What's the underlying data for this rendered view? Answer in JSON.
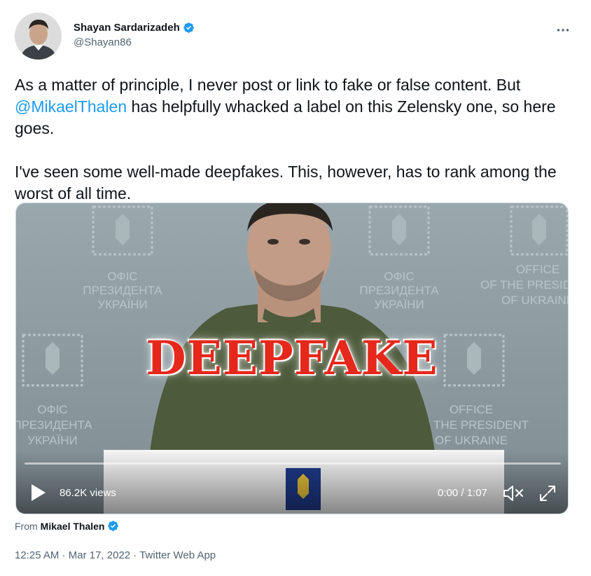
{
  "author": {
    "name": "Shayan Sardarizadeh",
    "handle": "@Shayan86",
    "verified": true
  },
  "tweet": {
    "para1_before": "As a matter of principle, I never post or link to fake or false content. But ",
    "para1_mention": "@MikaelThalen",
    "para1_after": " has helpfully whacked a label on this Zelensky one, so here goes.",
    "para2": "I've seen some well-made deepfakes. This, however, has to rank among the worst of all time."
  },
  "video": {
    "overlay_label": "DEEPFAKE",
    "views": "86.2K views",
    "time": "0:00 / 1:07",
    "progress": 0.0,
    "backdrop_text_1": "ОФІС",
    "backdrop_text_2": "ПРЕЗИДЕНТА",
    "backdrop_text_3": "УКРАЇНИ",
    "backdrop_text_4": "OFFICE",
    "backdrop_text_5": "OF THE PRESIDENT",
    "backdrop_text_6": "OF UKRAINE"
  },
  "attribution": {
    "prefix": "From",
    "name": "Mikael Thalen"
  },
  "meta": {
    "time": "12:25 AM",
    "sep1": " · ",
    "date": "Mar 17, 2022",
    "sep2": " · ",
    "source": "Twitter Web App"
  },
  "colors": {
    "accent": "#1d9bf0",
    "text": "#0f1419",
    "muted": "#536471",
    "overlay_red": "#e5281b"
  },
  "icons": {
    "verified": "verified-badge-icon",
    "more": "more-dots-icon",
    "play": "play-icon",
    "mute": "muted-speaker-icon",
    "fullscreen": "fullscreen-icon"
  }
}
